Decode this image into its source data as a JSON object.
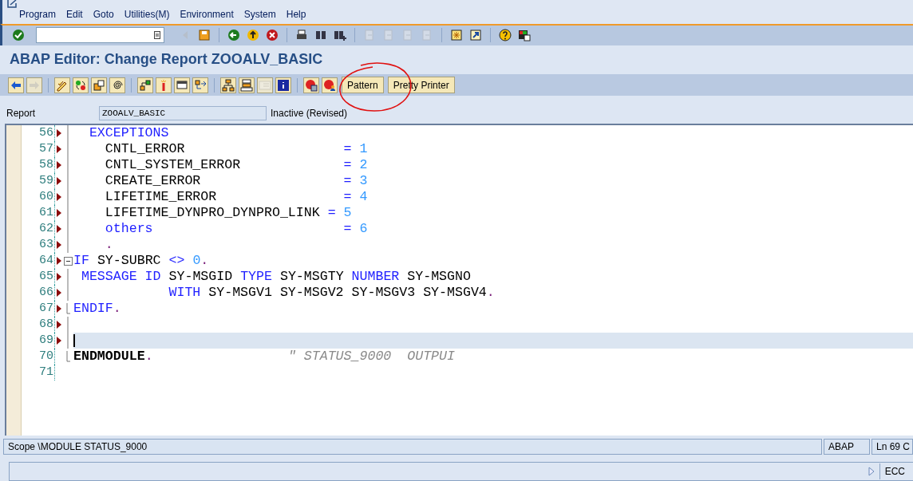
{
  "menu": [
    {
      "label": "Program"
    },
    {
      "label": "Edit"
    },
    {
      "label": "Goto"
    },
    {
      "label": "Utilities(M)"
    },
    {
      "label": "Environment"
    },
    {
      "label": "System"
    },
    {
      "label": "Help"
    }
  ],
  "standard_toolbar": [
    [
      {
        "kind": "enter",
        "disabled": false
      },
      {
        "kind": "command",
        "disabled": false
      },
      {
        "kind": "triangle",
        "disabled": true
      },
      {
        "kind": "save",
        "disabled": false
      }
    ],
    [
      {
        "kind": "back",
        "disabled": false
      },
      {
        "kind": "exit",
        "disabled": false
      },
      {
        "kind": "cancel",
        "disabled": false
      }
    ],
    [
      {
        "kind": "print",
        "disabled": false
      },
      {
        "kind": "find",
        "disabled": false
      },
      {
        "kind": "find-next",
        "disabled": false
      }
    ],
    [
      {
        "kind": "first-page",
        "disabled": true
      },
      {
        "kind": "prev-page",
        "disabled": true
      },
      {
        "kind": "next-page",
        "disabled": true
      },
      {
        "kind": "last-page",
        "disabled": true
      }
    ],
    [
      {
        "kind": "new-session",
        "disabled": false
      },
      {
        "kind": "shortcut",
        "disabled": false
      }
    ],
    [
      {
        "kind": "help",
        "disabled": false
      },
      {
        "kind": "layout",
        "disabled": false
      }
    ]
  ],
  "title": "ABAP Editor: Change Report ZOOALV_BASIC",
  "app_toolbar": [
    [
      {
        "kind": "back-arrow",
        "disabled": false
      },
      {
        "kind": "forward-arrow",
        "disabled": true
      }
    ],
    [
      {
        "kind": "check",
        "disabled": false
      },
      {
        "kind": "activate",
        "disabled": false
      },
      {
        "kind": "test",
        "disabled": false
      },
      {
        "kind": "where-used",
        "disabled": false
      }
    ],
    [
      {
        "kind": "object-list",
        "disabled": false
      },
      {
        "kind": "marker",
        "disabled": false
      },
      {
        "kind": "window",
        "disabled": false
      },
      {
        "kind": "enhance",
        "disabled": false
      }
    ],
    [
      {
        "kind": "hierarchy",
        "disabled": false
      },
      {
        "kind": "stack",
        "disabled": false
      },
      {
        "kind": "list",
        "disabled": true
      },
      {
        "kind": "info",
        "disabled": false
      }
    ],
    [
      {
        "kind": "breakpoint",
        "disabled": false
      },
      {
        "kind": "external-breakpoint",
        "disabled": false
      }
    ]
  ],
  "app_buttons": [
    {
      "label": "Pattern"
    },
    {
      "label": "Pretty Printer"
    }
  ],
  "report": {
    "label": "Report",
    "value": "ZOOALV_BASIC",
    "status": "Inactive (Revised)"
  },
  "code_lines": [
    {
      "number": "56",
      "marker": true,
      "kind": "line",
      "selected": false,
      "tokens": [
        {
          "kind": "keyword",
          "text": "  EXCEPTIONS"
        }
      ]
    },
    {
      "number": "57",
      "marker": true,
      "kind": "line",
      "selected": false,
      "tokens": [
        {
          "kind": "plain",
          "text": "    CNTL_ERROR                    "
        },
        {
          "kind": "keyword",
          "text": "="
        },
        {
          "kind": "number",
          "text": " 1"
        }
      ]
    },
    {
      "number": "58",
      "marker": true,
      "kind": "line",
      "selected": false,
      "tokens": [
        {
          "kind": "plain",
          "text": "    CNTL_SYSTEM_ERROR             "
        },
        {
          "kind": "keyword",
          "text": "="
        },
        {
          "kind": "number",
          "text": " 2"
        }
      ]
    },
    {
      "number": "59",
      "marker": true,
      "kind": "line",
      "selected": false,
      "tokens": [
        {
          "kind": "plain",
          "text": "    CREATE_ERROR                  "
        },
        {
          "kind": "keyword",
          "text": "="
        },
        {
          "kind": "number",
          "text": " 3"
        }
      ]
    },
    {
      "number": "60",
      "marker": true,
      "kind": "line",
      "selected": false,
      "tokens": [
        {
          "kind": "plain",
          "text": "    LIFETIME_ERROR                "
        },
        {
          "kind": "keyword",
          "text": "="
        },
        {
          "kind": "number",
          "text": " 4"
        }
      ]
    },
    {
      "number": "61",
      "marker": true,
      "kind": "line",
      "selected": false,
      "tokens": [
        {
          "kind": "plain",
          "text": "    LIFETIME_DYNPRO_DYNPRO_LINK "
        },
        {
          "kind": "keyword",
          "text": "="
        },
        {
          "kind": "number",
          "text": " 5"
        }
      ]
    },
    {
      "number": "62",
      "marker": true,
      "kind": "line",
      "selected": false,
      "tokens": [
        {
          "kind": "keyword",
          "text": "    others                        ="
        },
        {
          "kind": "number",
          "text": " 6"
        }
      ]
    },
    {
      "number": "63",
      "marker": true,
      "kind": "line",
      "selected": false,
      "tokens": [
        {
          "kind": "punct",
          "text": "    ."
        }
      ]
    },
    {
      "number": "64",
      "marker": true,
      "kind": "open",
      "selected": false,
      "tokens": [
        {
          "kind": "keyword",
          "text": "IF"
        },
        {
          "kind": "plain",
          "text": " SY-SUBRC "
        },
        {
          "kind": "keyword",
          "text": "<>"
        },
        {
          "kind": "number",
          "text": " 0"
        },
        {
          "kind": "punct",
          "text": "."
        }
      ]
    },
    {
      "number": "65",
      "marker": true,
      "kind": "line",
      "selected": false,
      "tokens": [
        {
          "kind": "keyword",
          "text": " MESSAGE ID"
        },
        {
          "kind": "plain",
          "text": " SY-MSGID "
        },
        {
          "kind": "keyword",
          "text": "TYPE"
        },
        {
          "kind": "plain",
          "text": " SY-MSGTY "
        },
        {
          "kind": "keyword",
          "text": "NUMBER"
        },
        {
          "kind": "plain",
          "text": " SY-MSGNO"
        }
      ]
    },
    {
      "number": "66",
      "marker": true,
      "kind": "line",
      "selected": false,
      "tokens": [
        {
          "kind": "keyword",
          "text": "            WITH"
        },
        {
          "kind": "plain",
          "text": " SY-MSGV1 SY-MSGV2 SY-MSGV3 SY-MSGV4"
        },
        {
          "kind": "punct",
          "text": "."
        }
      ]
    },
    {
      "number": "67",
      "marker": true,
      "kind": "end",
      "selected": false,
      "tokens": [
        {
          "kind": "keyword",
          "text": "ENDIF"
        },
        {
          "kind": "punct",
          "text": "."
        }
      ]
    },
    {
      "number": "68",
      "marker": true,
      "kind": "line",
      "selected": false
    },
    {
      "number": "69",
      "marker": true,
      "kind": "line",
      "selected": true
    },
    {
      "number": "70",
      "marker": false,
      "kind": "end",
      "selected": false,
      "tokens": [
        {
          "kind": "bold",
          "text": "ENDMODULE"
        },
        {
          "kind": "punct",
          "text": "."
        },
        {
          "kind": "comment",
          "text": "                 \" STATUS_9000  OUTPUI"
        }
      ]
    },
    {
      "number": "71",
      "marker": false,
      "kind": "none",
      "selected": false
    }
  ],
  "status_bar": {
    "scope": "Scope \\MODULE STATUS_9000",
    "language": "ABAP",
    "position": "Ln  69 C"
  },
  "system_bar": {
    "system": "ECC"
  }
}
